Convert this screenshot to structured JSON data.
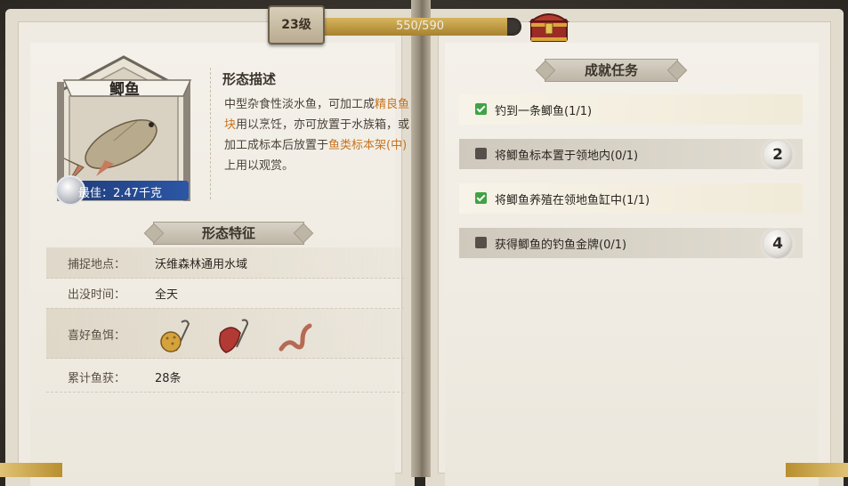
{
  "header": {
    "level_label": "23级",
    "xp_text": "550/590",
    "xp_progress": 0.932
  },
  "fish": {
    "name": "鲫鱼",
    "best_label": "最佳：2.47千克",
    "description_title": "形态描述",
    "description": {
      "part1": "中型杂食性淡水鱼，可加工成",
      "highlight1": "精良鱼块",
      "part2": "用以烹饪，亦可放置于水族箱，或加工成标本后放置于",
      "highlight2": "鱼类标本架(中)",
      "part3": "上用以观赏。"
    }
  },
  "features": {
    "title": "形态特征",
    "rows": [
      {
        "key": "捕捉地点：",
        "value": "沃维森林通用水域"
      },
      {
        "key": "出没时间：",
        "value": "全天"
      },
      {
        "key": "喜好鱼饵：",
        "value": ""
      },
      {
        "key": "累计鱼获：",
        "value": "28条"
      }
    ],
    "baits": [
      "corn-bait-icon",
      "meat-bait-icon",
      "worm-bait-icon"
    ]
  },
  "achievements": {
    "title": "成就任务",
    "quests": [
      {
        "text": "钓到一条鲫鱼(1/1)",
        "done": true,
        "reward": ""
      },
      {
        "text": "将鲫鱼标本置于领地内(0/1)",
        "done": false,
        "reward": "2"
      },
      {
        "text": "将鲫鱼养殖在领地鱼缸中(1/1)",
        "done": true,
        "reward": ""
      },
      {
        "text": "获得鲫鱼的钓鱼金牌(0/1)",
        "done": false,
        "reward": "4"
      }
    ]
  },
  "colors": {
    "highlight": "#c7731f",
    "check_done": "#3fa345",
    "badge_blue": "#2c56a5"
  }
}
